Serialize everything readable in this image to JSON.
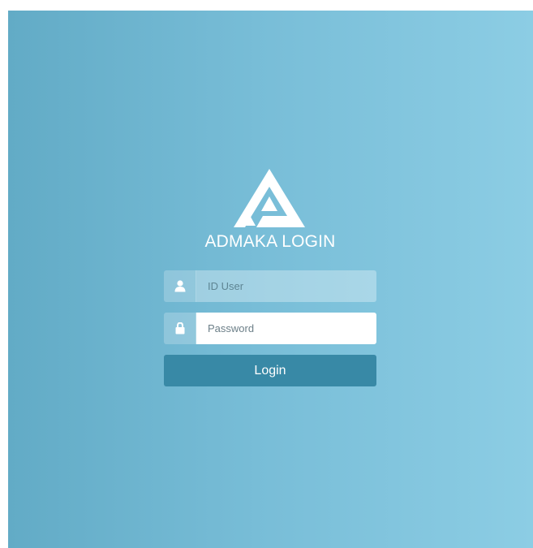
{
  "brand": {
    "title": "ADMAKA LOGIN",
    "logo_icon": "admaka-triangle-logo"
  },
  "form": {
    "user_field": {
      "icon": "user-icon",
      "placeholder": "ID User",
      "value": ""
    },
    "password_field": {
      "icon": "lock-icon",
      "placeholder": "Password",
      "value": ""
    },
    "login_label": "Login"
  },
  "colors": {
    "background_left": "#62abc6",
    "background_right": "#8ccde4",
    "button": "#3889a6",
    "text": "#ffffff"
  }
}
